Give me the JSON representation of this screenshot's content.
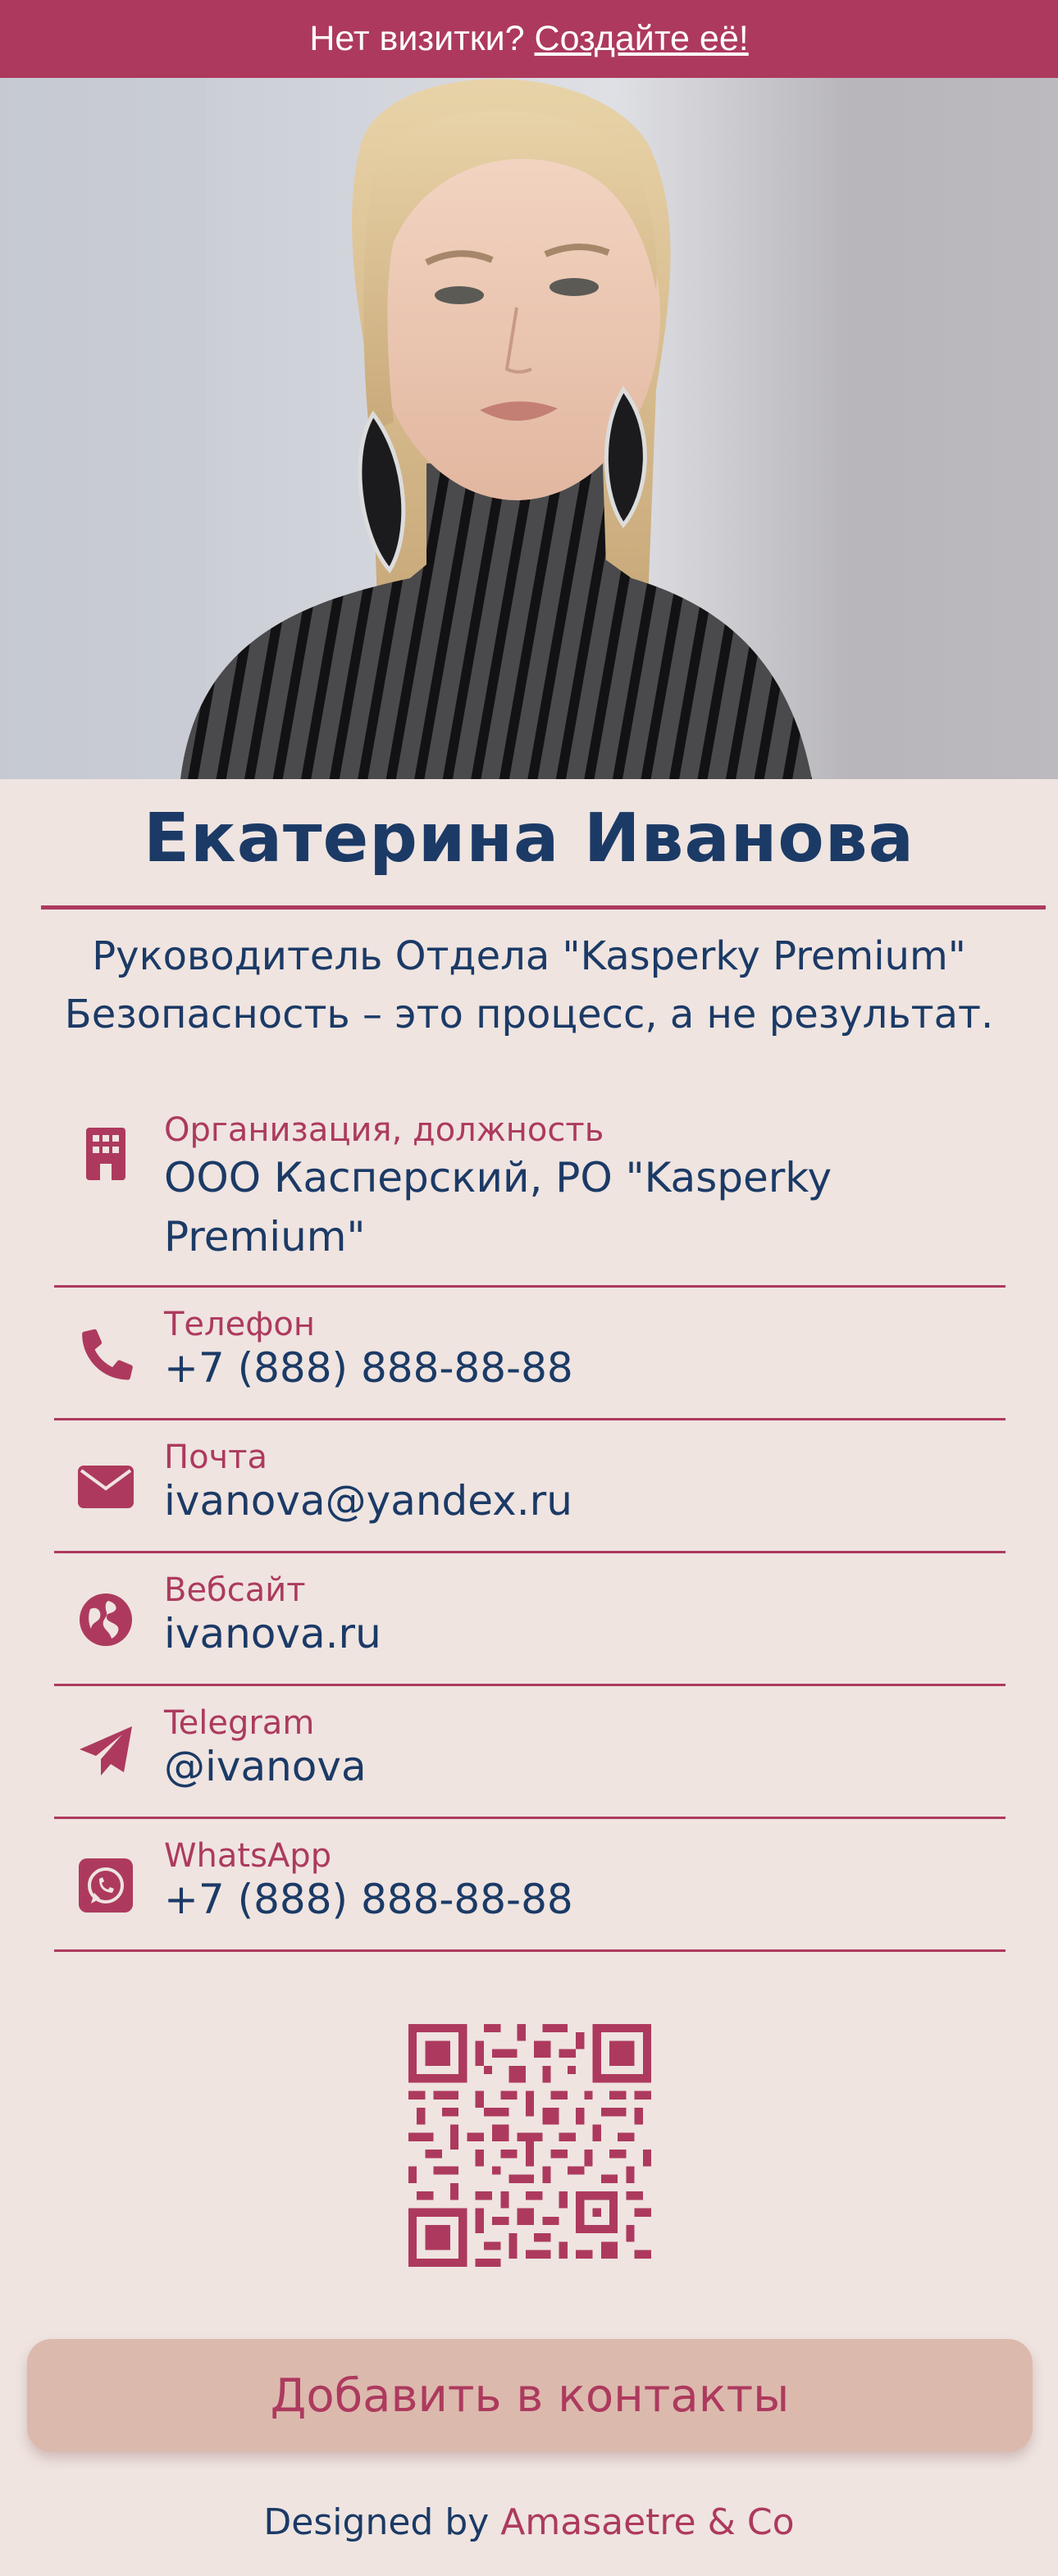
{
  "banner": {
    "text": "Нет визитки?",
    "link": "Создайте её!"
  },
  "profile": {
    "name": "Екатерина Иванова",
    "subtitle_line1": "Руководитель Отдела \"Kasperky Premium\"",
    "subtitle_line2": "Безопасность – это процесс, а не результат."
  },
  "contacts": [
    {
      "icon": "building-icon",
      "label": "Организация, должность",
      "value_line1": "ООО Касперский, РО \"Kasperky",
      "value_line2": "Premium\""
    },
    {
      "icon": "phone-icon",
      "label": "Телефон",
      "value": "+7 (888) 888-88-88"
    },
    {
      "icon": "envelope-icon",
      "label": "Почта",
      "value": "ivanova@yandex.ru"
    },
    {
      "icon": "globe-icon",
      "label": "Вебсайт",
      "value": "ivanova.ru"
    },
    {
      "icon": "paper-plane-icon",
      "label": "Telegram",
      "value": "@ivanova"
    },
    {
      "icon": "whatsapp-icon",
      "label": "WhatsApp",
      "value": "+7 (888) 888-88-88"
    }
  ],
  "actions": {
    "add_contact": "Добавить в контакты"
  },
  "footer": {
    "prefix": "Designed by",
    "brand": "Amasaetre & Co"
  },
  "colors": {
    "accent": "#ad3a5e",
    "text": "#1b3a66",
    "background": "#efe4e0",
    "button": "#dcb9ad"
  }
}
